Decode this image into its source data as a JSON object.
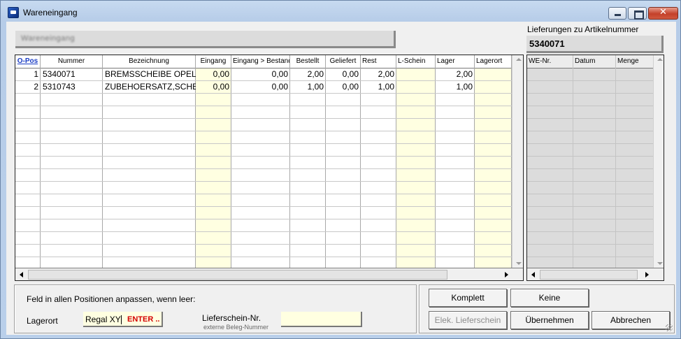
{
  "window": {
    "title": "Wareneingang"
  },
  "header": {
    "blurred_text": "Wareneingang"
  },
  "lieferungen": {
    "label": "Lieferungen zu Artikelnummer",
    "article_number": "5340071"
  },
  "grid": {
    "columns": [
      "O-Pos",
      "Nummer",
      "Bezeichnung",
      "Eingang",
      "Eingang > Bestand",
      "Bestellt",
      "Geliefert",
      "Rest",
      "L-Schein",
      "Lager",
      "Lagerort"
    ],
    "rows": [
      {
        "pos": "1",
        "nummer": "5340071",
        "bezeichnung": "BREMSSCHEIBE OPEL",
        "eingang": "0,00",
        "eingang_bestand": "0,00",
        "bestellt": "2,00",
        "geliefert": "0,00",
        "rest": "2,00",
        "lschein": "",
        "lager": "2,00",
        "lagerort": ""
      },
      {
        "pos": "2",
        "nummer": "5310743",
        "bezeichnung": "ZUBEHOERSATZ,SCHE",
        "eingang": "0,00",
        "eingang_bestand": "0,00",
        "bestellt": "1,00",
        "geliefert": "0,00",
        "rest": "1,00",
        "lschein": "",
        "lager": "1,00",
        "lagerort": ""
      }
    ]
  },
  "deliveries_grid": {
    "columns": [
      "WE-Nr.",
      "Datum",
      "Menge"
    ]
  },
  "bottom": {
    "feld_label": "Feld in allen Positionen anpassen, wenn leer:",
    "lagerort_label": "Lagerort",
    "lagerort_value": "Regal XY",
    "enter_hint": "ENTER ..",
    "lieferschein_label": "Lieferschein-Nr.",
    "lieferschein_sub": "externe Beleg-Nummer",
    "lieferschein_value": ""
  },
  "buttons": {
    "komplett": "Komplett",
    "keine": "Keine",
    "elek_lieferschein": "Elek. Lieferschein",
    "uebernehmen": "Übernehmen",
    "abbrechen": "Abbrechen"
  }
}
